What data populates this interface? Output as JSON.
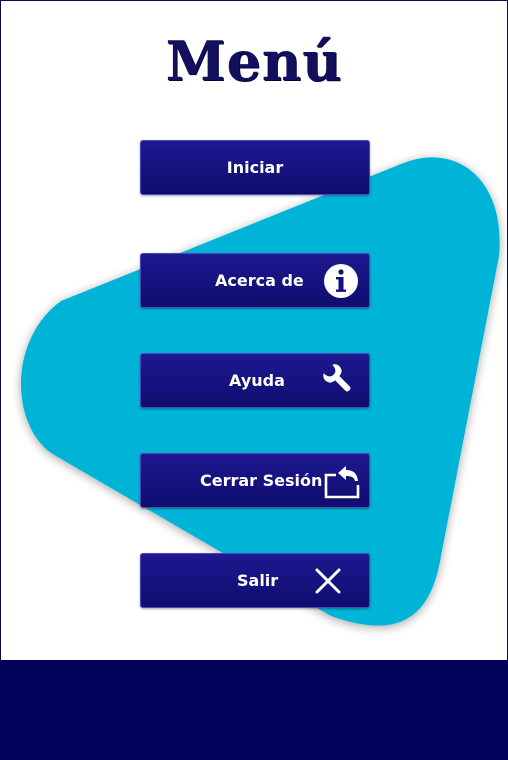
{
  "menu": {
    "title": "Menú",
    "buttons": [
      {
        "id": "iniciar",
        "label": "Iniciar",
        "icon": ""
      },
      {
        "id": "acerca-de",
        "label": "Acerca de",
        "icon": "info-icon"
      },
      {
        "id": "ayuda",
        "label": "Ayuda",
        "icon": "wrench-icon"
      },
      {
        "id": "cerrar-sesion",
        "label": "Cerrar Sesión",
        "icon": "logout-icon"
      },
      {
        "id": "salir",
        "label": "Salir",
        "icon": "close-icon"
      }
    ]
  },
  "colors": {
    "primary": "#15127e",
    "accent_shape": "#00b4d8",
    "footer": "#02015a",
    "title": "#12105c"
  }
}
